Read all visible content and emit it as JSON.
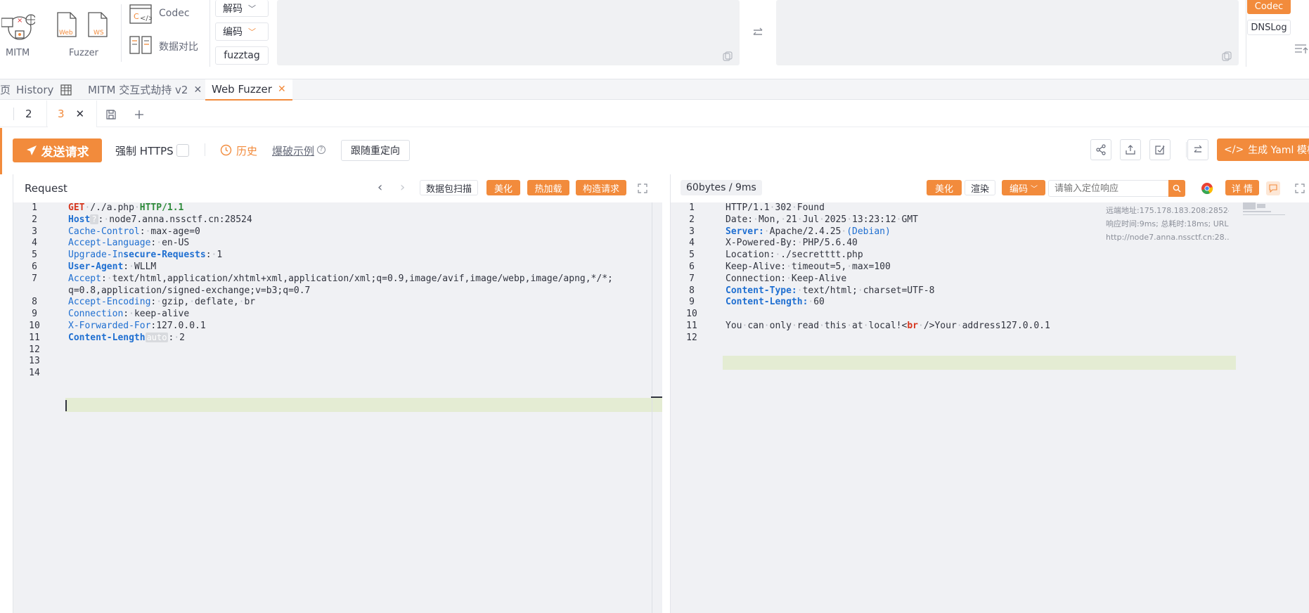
{
  "toolbar": {
    "mitm_label": "MITM",
    "fuzzer_label": "Fuzzer",
    "codec_label": "Codec",
    "compare_label": "数据对比",
    "decode_label": "解码",
    "encode_label": "编码",
    "fuzztag_label": "fuzztag",
    "web_icon_text": "Web",
    "ws_icon_text": "WS",
    "codec_tag": "Codec",
    "dnslog_tag": "DNSLog"
  },
  "tabs": {
    "home_frag": "页",
    "history": "History",
    "mitm": "MITM 交互式劫持 v2",
    "fuzzer": "Web Fuzzer"
  },
  "subtabs": [
    "2",
    "3"
  ],
  "actions": {
    "send": "发送请求",
    "force_https": "强制 HTTPS",
    "history": "历史",
    "examples": "爆破示例",
    "redirect": "跟随重定向",
    "yaml": "生成 Yaml 模板"
  },
  "request": {
    "title": "Request",
    "scan": "数据包扫描",
    "beautify": "美化",
    "hot_load": "热加载",
    "build": "构造请求",
    "lines": [
      {
        "n": "1",
        "parts": [
          [
            "kw",
            "GET"
          ],
          [
            "dot",
            "·"
          ],
          [
            "",
            "/./a.php"
          ],
          [
            "dot",
            "·"
          ],
          [
            "proto",
            "HTTP/1.1"
          ]
        ]
      },
      {
        "n": "2",
        "parts": [
          [
            "keyb",
            "Host"
          ],
          [
            "hint",
            "?"
          ],
          [
            "",
            ":"
          ],
          [
            "dot",
            "·"
          ],
          [
            "",
            "node7.anna.nssctf.cn:28524"
          ]
        ]
      },
      {
        "n": "3",
        "parts": [
          [
            "key",
            "Cache-Control"
          ],
          [
            "",
            ":"
          ],
          [
            "dot",
            "·"
          ],
          [
            "",
            "max-age=0"
          ]
        ]
      },
      {
        "n": "4",
        "parts": [
          [
            "key",
            "Accept-Language"
          ],
          [
            "",
            ":"
          ],
          [
            "dot",
            "·"
          ],
          [
            "",
            "en-US"
          ]
        ]
      },
      {
        "n": "5",
        "parts": [
          [
            "key",
            "Upgrade-In"
          ],
          [
            "keyb",
            "secure-Requests"
          ],
          [
            "",
            ":"
          ],
          [
            "dot",
            "·"
          ],
          [
            "",
            "1"
          ]
        ]
      },
      {
        "n": "6",
        "parts": [
          [
            "keyb",
            "User-Agent"
          ],
          [
            "",
            ":"
          ],
          [
            "dot",
            "·"
          ],
          [
            "",
            "WLLM"
          ]
        ]
      },
      {
        "n": "7",
        "parts": [
          [
            "key",
            "Accept"
          ],
          [
            "",
            ":"
          ],
          [
            "dot",
            "·"
          ],
          [
            "",
            "text/html,application/xhtml+xml,application/xml;q=0.9,image/avif,image/webp,image/apng,*/*;"
          ]
        ]
      },
      {
        "n": "",
        "parts": [
          [
            "",
            "q=0.8,application/signed-exchange;v=b3;q=0.7"
          ]
        ]
      },
      {
        "n": "8",
        "parts": [
          [
            "key",
            "Accept-Encoding"
          ],
          [
            "",
            ":"
          ],
          [
            "dot",
            "·"
          ],
          [
            "",
            "gzip,"
          ],
          [
            "dot",
            "·"
          ],
          [
            "",
            "deflate,"
          ],
          [
            "dot",
            "·"
          ],
          [
            "",
            "br"
          ]
        ]
      },
      {
        "n": "9",
        "parts": [
          [
            "key",
            "Connection"
          ],
          [
            "",
            ":"
          ],
          [
            "dot",
            "·"
          ],
          [
            "",
            "keep-alive"
          ]
        ]
      },
      {
        "n": "10",
        "parts": [
          [
            "key",
            "X-Forwarded-For"
          ],
          [
            "",
            ":127.0.0.1"
          ]
        ]
      },
      {
        "n": "11",
        "parts": [
          [
            "keyb",
            "Content-Length"
          ],
          [
            "hint",
            "auto"
          ],
          [
            "",
            ":"
          ],
          [
            "dot",
            "·"
          ],
          [
            "",
            "2"
          ]
        ]
      },
      {
        "n": "12",
        "parts": []
      },
      {
        "n": "13",
        "parts": []
      },
      {
        "n": "14",
        "parts": []
      }
    ]
  },
  "response": {
    "size": "60bytes / 9ms",
    "beautify": "美化",
    "render": "渲染",
    "encode": "编码",
    "search_placeholder": "请输入定位响应",
    "details": "详 情",
    "info_line1": "远端地址:175.178.183.208:28524;",
    "info_line2": "响应时间:9ms; 总耗时:18ms; URL:",
    "info_line3": "http://node7.anna.nssctf.cn:28...",
    "lines": [
      {
        "n": "1",
        "parts": [
          [
            "",
            "HTTP/1.1"
          ],
          [
            "dot",
            "·"
          ],
          [
            "",
            "302"
          ],
          [
            "dot",
            "·"
          ],
          [
            "",
            "Found"
          ]
        ]
      },
      {
        "n": "2",
        "parts": [
          [
            "",
            "Date:"
          ],
          [
            "dot",
            "·"
          ],
          [
            "",
            "Mon,"
          ],
          [
            "dot",
            "·"
          ],
          [
            "",
            "21"
          ],
          [
            "dot",
            "·"
          ],
          [
            "",
            "Jul"
          ],
          [
            "dot",
            "·"
          ],
          [
            "",
            "2025"
          ],
          [
            "dot",
            "·"
          ],
          [
            "",
            "13:23:12"
          ],
          [
            "dot",
            "·"
          ],
          [
            "",
            "GMT"
          ]
        ]
      },
      {
        "n": "3",
        "parts": [
          [
            "keyb",
            "Server:"
          ],
          [
            "dot",
            "·"
          ],
          [
            "",
            "Apache/2.4.25"
          ],
          [
            "dot",
            "·"
          ],
          [
            "key",
            "(Debian)"
          ]
        ]
      },
      {
        "n": "4",
        "parts": [
          [
            "",
            "X-Powered-By:"
          ],
          [
            "dot",
            "·"
          ],
          [
            "",
            "PHP/5.6.40"
          ]
        ]
      },
      {
        "n": "5",
        "parts": [
          [
            "",
            "Location:"
          ],
          [
            "dot",
            "·"
          ],
          [
            "",
            "./secretttt.php"
          ]
        ]
      },
      {
        "n": "6",
        "parts": [
          [
            "",
            "Keep-Alive:"
          ],
          [
            "dot",
            "·"
          ],
          [
            "",
            "timeout=5,"
          ],
          [
            "dot",
            "·"
          ],
          [
            "",
            "max=100"
          ]
        ]
      },
      {
        "n": "7",
        "parts": [
          [
            "",
            "Connection:"
          ],
          [
            "dot",
            "·"
          ],
          [
            "",
            "Keep-Alive"
          ]
        ]
      },
      {
        "n": "8",
        "parts": [
          [
            "keyb",
            "Content-Type:"
          ],
          [
            "dot",
            "·"
          ],
          [
            "",
            "text/html;"
          ],
          [
            "dot",
            "·"
          ],
          [
            "",
            "charset=UTF-8"
          ]
        ]
      },
      {
        "n": "9",
        "parts": [
          [
            "keyb",
            "Content-Length:"
          ],
          [
            "dot",
            "·"
          ],
          [
            "",
            "60"
          ]
        ]
      },
      {
        "n": "10",
        "parts": []
      },
      {
        "n": "11",
        "parts": [
          [
            "",
            "You"
          ],
          [
            "dot",
            "·"
          ],
          [
            "",
            "can"
          ],
          [
            "dot",
            "·"
          ],
          [
            "",
            "only"
          ],
          [
            "dot",
            "·"
          ],
          [
            "",
            "read"
          ],
          [
            "dot",
            "·"
          ],
          [
            "",
            "this"
          ],
          [
            "dot",
            "·"
          ],
          [
            "",
            "at"
          ],
          [
            "dot",
            "·"
          ],
          [
            "",
            "local!<"
          ],
          [
            "kw",
            "br"
          ],
          [
            "dot",
            "·"
          ],
          [
            "",
            "/>Your"
          ],
          [
            "dot",
            "·"
          ],
          [
            "",
            "address127.0.0.1"
          ]
        ]
      },
      {
        "n": "12",
        "parts": []
      }
    ]
  }
}
